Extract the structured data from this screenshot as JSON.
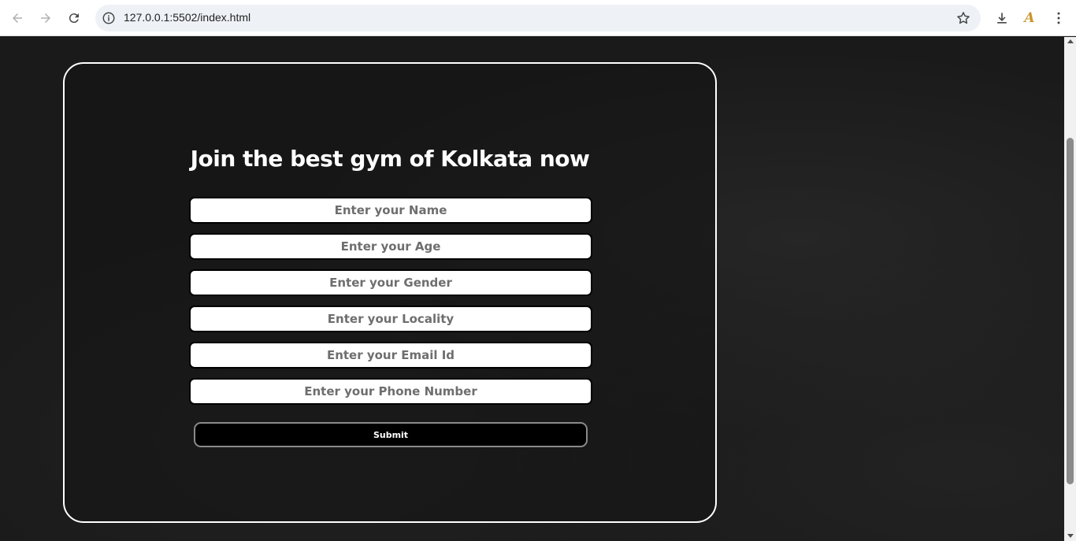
{
  "browser": {
    "url": "127.0.0.1:5502/index.html",
    "icons": [
      "back-arrow-icon",
      "forward-arrow-icon",
      "reload-icon",
      "site-info-icon",
      "bookmark-star-icon",
      "download-icon",
      "profile-icon",
      "kebab-menu-icon"
    ]
  },
  "form": {
    "heading": "Join the best gym of Kolkata now",
    "fields": [
      {
        "placeholder": "Enter your Name"
      },
      {
        "placeholder": "Enter your Age"
      },
      {
        "placeholder": "Enter your Gender"
      },
      {
        "placeholder": "Enter your Locality"
      },
      {
        "placeholder": "Enter your Email Id"
      },
      {
        "placeholder": "Enter your Phone Number"
      }
    ],
    "submit_label": "Submit"
  },
  "colors": {
    "background": "#1a1a1a",
    "card_border": "#ffffff",
    "submit_bg": "#000000"
  }
}
